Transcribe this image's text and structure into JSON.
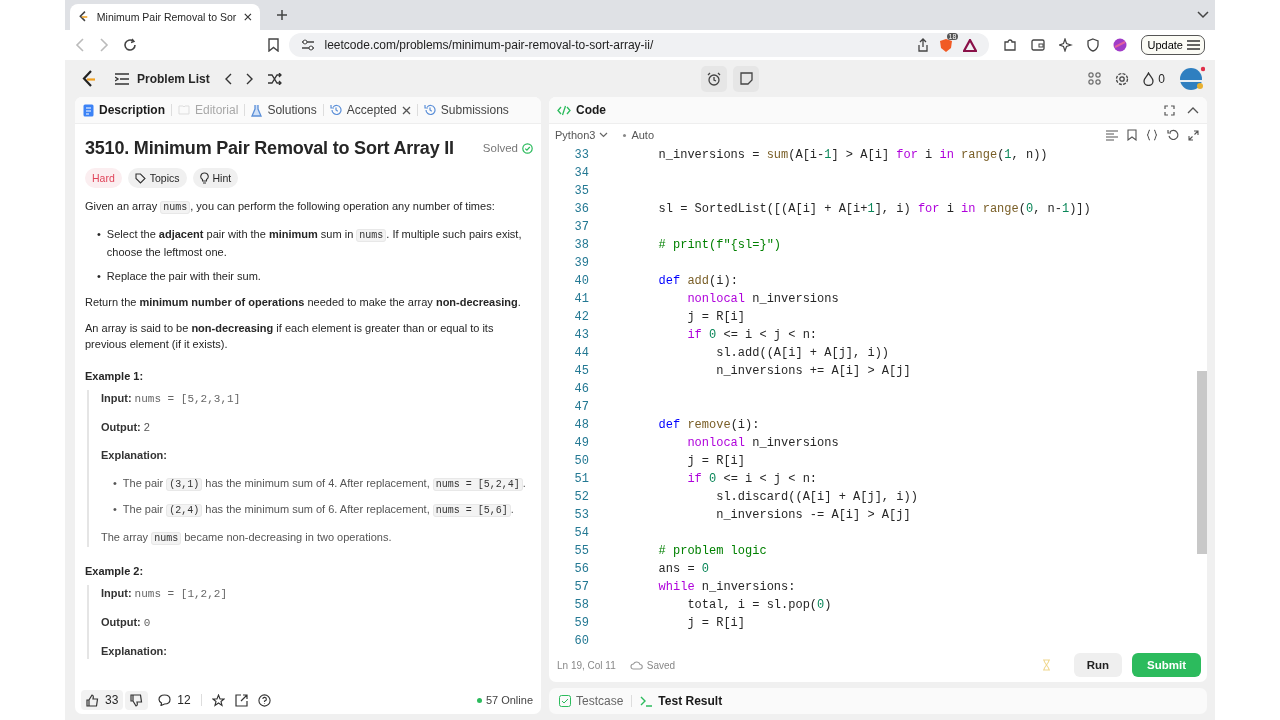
{
  "browser": {
    "tab_title": "Minimum Pair Removal to Sor",
    "url": "leetcode.com/problems/minimum-pair-removal-to-sort-array-ii/",
    "shield_count": "18",
    "update_label": "Update"
  },
  "nav": {
    "problem_list": "Problem List",
    "streak": "0"
  },
  "left_tabs": [
    {
      "label": "Description",
      "selected": true,
      "disabled": false,
      "closable": false
    },
    {
      "label": "Editorial",
      "selected": false,
      "disabled": true,
      "closable": false
    },
    {
      "label": "Solutions",
      "selected": false,
      "disabled": false,
      "closable": false
    },
    {
      "label": "Accepted",
      "selected": false,
      "disabled": false,
      "closable": true
    },
    {
      "label": "Submissions",
      "selected": false,
      "disabled": false,
      "closable": false
    }
  ],
  "problem": {
    "title": "3510. Minimum Pair Removal to Sort Array II",
    "status": "Solved",
    "tags": [
      {
        "label": "Hard",
        "kind": "difficulty"
      },
      {
        "label": "Topics",
        "kind": "topics"
      },
      {
        "label": "Hint",
        "kind": "hint"
      }
    ],
    "blocks": [
      {
        "kind": "para",
        "parts": [
          {
            "text": "Given an array ",
            "kind": "text"
          },
          {
            "text": "nums",
            "kind": "code"
          },
          {
            "text": ", you can perform the following operation any number of times:",
            "kind": "text"
          }
        ]
      },
      {
        "kind": "bullets",
        "marker": "•",
        "items": [
          [
            {
              "text": "Select the ",
              "kind": "text"
            },
            {
              "text": "adjacent",
              "kind": "bold"
            },
            {
              "text": " pair with the ",
              "kind": "text"
            },
            {
              "text": "minimum",
              "kind": "bold"
            },
            {
              "text": " sum in ",
              "kind": "text"
            },
            {
              "text": "nums",
              "kind": "code"
            },
            {
              "text": ". If multiple such pairs exist, choose the leftmost one.",
              "kind": "text"
            }
          ],
          [
            {
              "text": "Replace the pair with their sum.",
              "kind": "text"
            }
          ]
        ]
      },
      {
        "kind": "para",
        "parts": [
          {
            "text": "Return the ",
            "kind": "text"
          },
          {
            "text": "minimum number of operations",
            "kind": "bold"
          },
          {
            "text": " needed to make the array ",
            "kind": "text"
          },
          {
            "text": "non-decreasing",
            "kind": "bold"
          },
          {
            "text": ".",
            "kind": "text"
          }
        ]
      },
      {
        "kind": "para",
        "parts": [
          {
            "text": "An array is said to be ",
            "kind": "text"
          },
          {
            "text": "non-decreasing",
            "kind": "bold"
          },
          {
            "text": " if each element is greater than or equal to its previous element (if it exists).",
            "kind": "text"
          }
        ]
      },
      {
        "kind": "heading",
        "text": "Example 1:"
      },
      {
        "kind": "example",
        "items": [
          {
            "kind": "line",
            "label": "Input:",
            "parts": [
              {
                "text": "nums = [5,2,3,1]",
                "kind": "mono"
              }
            ]
          },
          {
            "kind": "line",
            "label": "Output:",
            "parts": [
              {
                "text": "2",
                "kind": "text"
              }
            ]
          },
          {
            "kind": "line",
            "label": "Explanation:"
          },
          {
            "kind": "bullets",
            "marker": "•",
            "items": [
              [
                {
                  "text": "The pair ",
                  "kind": "text"
                },
                {
                  "text": "(3,1)",
                  "kind": "code"
                },
                {
                  "text": " has the minimum sum of 4. After replacement, ",
                  "kind": "text"
                },
                {
                  "text": "nums = [5,2,4]",
                  "kind": "code"
                },
                {
                  "text": ".",
                  "kind": "text"
                }
              ],
              [
                {
                  "text": "The pair ",
                  "kind": "text"
                },
                {
                  "text": "(2,4)",
                  "kind": "code"
                },
                {
                  "text": " has the minimum sum of 6. After replacement, ",
                  "kind": "text"
                },
                {
                  "text": "nums = [5,6]",
                  "kind": "code"
                },
                {
                  "text": ".",
                  "kind": "text"
                }
              ]
            ]
          },
          {
            "kind": "para",
            "parts": [
              {
                "text": "The array ",
                "kind": "text"
              },
              {
                "text": "nums",
                "kind": "code"
              },
              {
                "text": " became non-decreasing in two operations.",
                "kind": "text"
              }
            ]
          }
        ]
      },
      {
        "kind": "heading",
        "text": "Example 2:"
      },
      {
        "kind": "example",
        "items": [
          {
            "kind": "line",
            "label": "Input:",
            "parts": [
              {
                "text": "nums = [1,2,2]",
                "kind": "mono"
              }
            ]
          },
          {
            "kind": "line",
            "label": "Output:",
            "parts": [
              {
                "text": "0",
                "kind": "mono"
              }
            ]
          },
          {
            "kind": "line",
            "label": "Explanation:"
          }
        ]
      }
    ]
  },
  "left_footer": {
    "likes": "33",
    "comments": "12",
    "online": "57 Online"
  },
  "editor": {
    "tab": "Code",
    "language": "Python3",
    "mode": "Auto",
    "position": "Ln 19, Col 11",
    "save_state": "Saved",
    "run": "Run",
    "submit": "Submit",
    "lines": [
      {
        "no": "33",
        "segs": [
          {
            "text": "        n_inversions = ",
            "kind": "plain"
          },
          {
            "text": "sum",
            "kind": "function"
          },
          {
            "text": "(A[i-",
            "kind": "plain"
          },
          {
            "text": "1",
            "kind": "number"
          },
          {
            "text": "] > A[i] ",
            "kind": "plain"
          },
          {
            "text": "for",
            "kind": "keyword"
          },
          {
            "text": " i ",
            "kind": "plain"
          },
          {
            "text": "in",
            "kind": "keyword"
          },
          {
            "text": " range",
            "kind": "function"
          },
          {
            "text": "(",
            "kind": "plain"
          },
          {
            "text": "1",
            "kind": "number"
          },
          {
            "text": ", n))",
            "kind": "plain"
          }
        ]
      },
      {
        "no": "34"
      },
      {
        "no": "35"
      },
      {
        "no": "36",
        "segs": [
          {
            "text": "        sl = SortedList([(A[i] + A[i+",
            "kind": "plain"
          },
          {
            "text": "1",
            "kind": "number"
          },
          {
            "text": "], i) ",
            "kind": "plain"
          },
          {
            "text": "for",
            "kind": "keyword"
          },
          {
            "text": " i ",
            "kind": "plain"
          },
          {
            "text": "in",
            "kind": "keyword"
          },
          {
            "text": " range",
            "kind": "function"
          },
          {
            "text": "(",
            "kind": "plain"
          },
          {
            "text": "0",
            "kind": "number"
          },
          {
            "text": ", n-",
            "kind": "plain"
          },
          {
            "text": "1",
            "kind": "number"
          },
          {
            "text": ")])",
            "kind": "plain"
          }
        ]
      },
      {
        "no": "37"
      },
      {
        "no": "38",
        "segs": [
          {
            "text": "        # print(f\"{sl=}\")",
            "kind": "comment"
          }
        ]
      },
      {
        "no": "39"
      },
      {
        "no": "40",
        "segs": [
          {
            "text": "        def",
            "kind": "def"
          },
          {
            "text": " add",
            "kind": "function"
          },
          {
            "text": "(i):",
            "kind": "plain"
          }
        ]
      },
      {
        "no": "41",
        "segs": [
          {
            "text": "            nonlocal",
            "kind": "keyword"
          },
          {
            "text": " n_inversions",
            "kind": "plain"
          }
        ]
      },
      {
        "no": "42",
        "segs": [
          {
            "text": "            j = R[i]",
            "kind": "plain"
          }
        ]
      },
      {
        "no": "43",
        "segs": [
          {
            "text": "            if",
            "kind": "keyword"
          },
          {
            "text": " 0",
            "kind": "number"
          },
          {
            "text": " <= i < j < n:",
            "kind": "plain"
          }
        ]
      },
      {
        "no": "44",
        "segs": [
          {
            "text": "                sl.add((A[i] + A[j], i))",
            "kind": "plain"
          }
        ]
      },
      {
        "no": "45",
        "segs": [
          {
            "text": "                n_inversions += A[i] > A[j]",
            "kind": "plain"
          }
        ]
      },
      {
        "no": "46"
      },
      {
        "no": "47"
      },
      {
        "no": "48",
        "segs": [
          {
            "text": "        def",
            "kind": "def"
          },
          {
            "text": " remove",
            "kind": "function"
          },
          {
            "text": "(i):",
            "kind": "plain"
          }
        ]
      },
      {
        "no": "49",
        "segs": [
          {
            "text": "            nonlocal",
            "kind": "keyword"
          },
          {
            "text": " n_inversions",
            "kind": "plain"
          }
        ]
      },
      {
        "no": "50",
        "segs": [
          {
            "text": "            j = R[i]",
            "kind": "plain"
          }
        ]
      },
      {
        "no": "51",
        "segs": [
          {
            "text": "            if",
            "kind": "keyword"
          },
          {
            "text": " 0",
            "kind": "number"
          },
          {
            "text": " <= i < j < n:",
            "kind": "plain"
          }
        ]
      },
      {
        "no": "52",
        "segs": [
          {
            "text": "                sl.discard((A[i] + A[j], i))",
            "kind": "plain"
          }
        ]
      },
      {
        "no": "53",
        "segs": [
          {
            "text": "                n_inversions -= A[i] > A[j]",
            "kind": "plain"
          }
        ]
      },
      {
        "no": "54"
      },
      {
        "no": "55",
        "segs": [
          {
            "text": "        # problem logic",
            "kind": "comment"
          }
        ]
      },
      {
        "no": "56",
        "segs": [
          {
            "text": "        ans = ",
            "kind": "plain"
          },
          {
            "text": "0",
            "kind": "number"
          }
        ]
      },
      {
        "no": "57",
        "segs": [
          {
            "text": "        while",
            "kind": "keyword"
          },
          {
            "text": " n_inversions:",
            "kind": "plain"
          }
        ]
      },
      {
        "no": "58",
        "segs": [
          {
            "text": "            total, i = sl.pop(",
            "kind": "plain"
          },
          {
            "text": "0",
            "kind": "number"
          },
          {
            "text": ")",
            "kind": "plain"
          }
        ]
      },
      {
        "no": "59",
        "segs": [
          {
            "text": "            j = R[i]",
            "kind": "plain"
          }
        ]
      },
      {
        "no": "60"
      }
    ]
  },
  "bottom_tabs": [
    {
      "label": "Testcase",
      "selected": false
    },
    {
      "label": "Test Result",
      "selected": true
    }
  ]
}
